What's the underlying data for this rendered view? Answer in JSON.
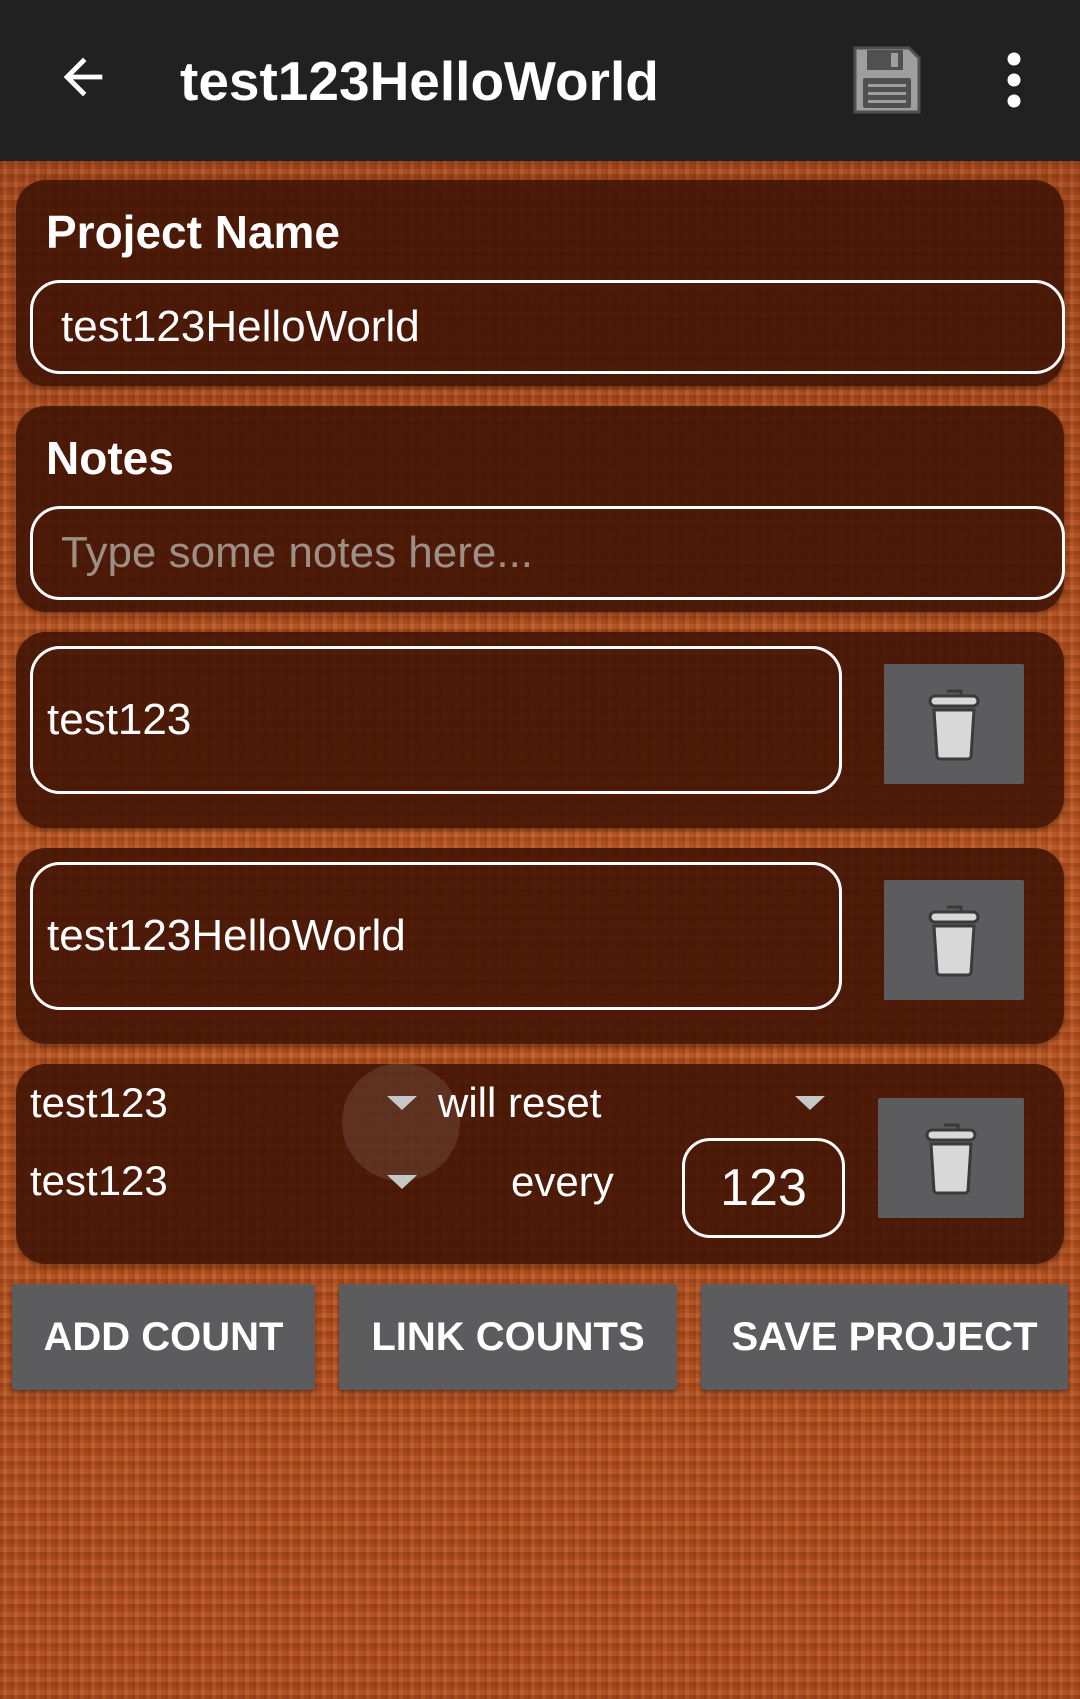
{
  "app_bar": {
    "title": "test123HelloWorld",
    "back_icon": "arrow-back-icon",
    "save_icon": "floppy-disk-icon",
    "menu_icon": "more-vert-icon"
  },
  "project_name": {
    "label": "Project Name",
    "value": "test123HelloWorld"
  },
  "notes": {
    "label": "Notes",
    "value": "",
    "placeholder": "Type some notes here..."
  },
  "counts": [
    {
      "name": "test123"
    },
    {
      "name": "test123HelloWorld"
    }
  ],
  "link": {
    "source_count": "test123",
    "action": "will reset",
    "target_count": "test123",
    "every_label": "every",
    "every_value": "123"
  },
  "buttons": {
    "add_count": "ADD COUNT",
    "link_counts": "LINK COUNTS",
    "save_project": "SAVE PROJECT"
  },
  "colors": {
    "app_bar": "#212121",
    "card": "#3c1204",
    "button": "#5c5c5e",
    "background": "#b94f1c"
  }
}
